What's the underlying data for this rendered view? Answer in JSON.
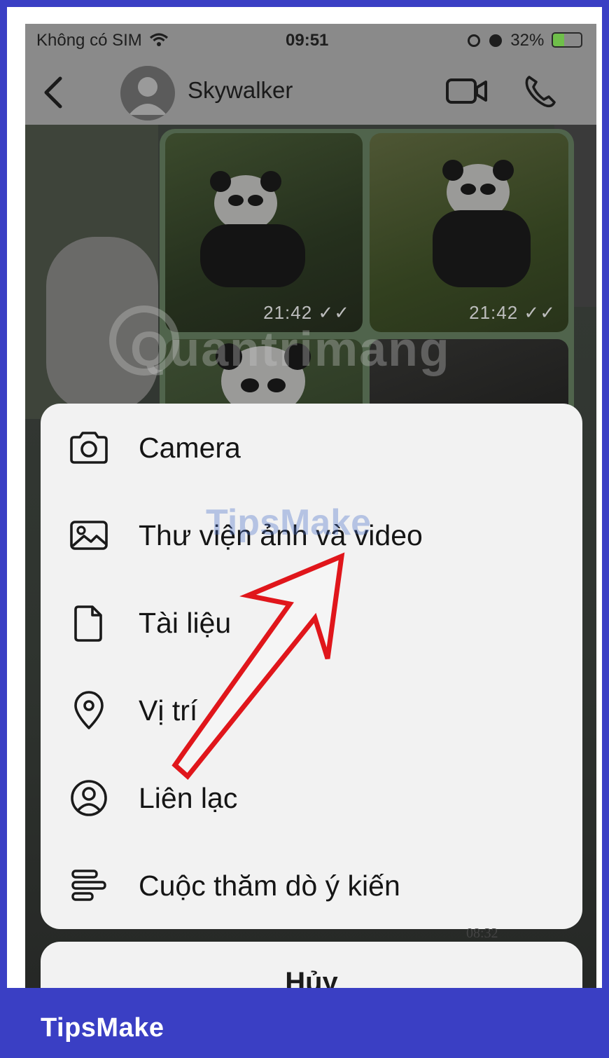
{
  "status_bar": {
    "carrier": "Không có SIM",
    "time": "09:51",
    "battery": "32%"
  },
  "chat_header": {
    "contact_name": "Skywalker"
  },
  "photos": {
    "timestamp_1": "21:42 ✓✓",
    "timestamp_2": "21:42 ✓✓"
  },
  "watermark": "Quantrimang",
  "watermark_overlay": "TipsMake",
  "action_sheet": {
    "items": [
      {
        "label": "Camera",
        "icon": "camera-icon"
      },
      {
        "label": "Thư viện ảnh và video",
        "icon": "photo-library-icon"
      },
      {
        "label": "Tài liệu",
        "icon": "document-icon"
      },
      {
        "label": "Vị trí",
        "icon": "location-pin-icon"
      },
      {
        "label": "Liên lạc",
        "icon": "contact-icon"
      },
      {
        "label": "Cuộc thăm dò ý kiến",
        "icon": "poll-icon"
      }
    ],
    "cancel_label": "Hủy",
    "peek_time": "08:32"
  },
  "brand": "TipsMake",
  "colors": {
    "frame": "#3a3fc4",
    "sheet": "#f2f2f2",
    "annotation_arrow": "#e0161b"
  }
}
